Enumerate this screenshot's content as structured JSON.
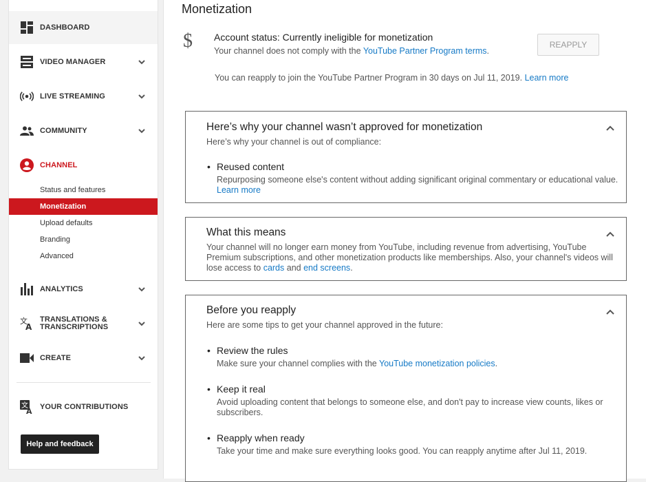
{
  "sidebar": {
    "dashboard": "DASHBOARD",
    "video_manager": "VIDEO MANAGER",
    "live_streaming": "LIVE STREAMING",
    "community": "COMMUNITY",
    "channel": "CHANNEL",
    "channel_sub": [
      "Status and features",
      "Monetization",
      "Upload defaults",
      "Branding",
      "Advanced"
    ],
    "analytics": "ANALYTICS",
    "translations_line1": "TRANSLATIONS &",
    "translations_line2": "TRANSCRIPTIONS",
    "create": "CREATE",
    "contributions": "YOUR CONTRIBUTIONS",
    "help_button": "Help and feedback"
  },
  "main": {
    "title": "Monetization",
    "dollar_glyph": "$",
    "account_status": "Account status: Currently ineligible for monetization",
    "account_sub_text": "Your channel does not comply with the ",
    "account_sub_link": "YouTube Partner Program terms",
    "account_sub_end": ".",
    "reapply_button": "REAPPLY",
    "reapply_note": "You can reapply to join the YouTube Partner Program in 30 days on Jul 11, 2019.",
    "reapply_note_link": "Learn more"
  },
  "cards": {
    "why": {
      "title": "Here’s why your channel wasn’t approved for monetization",
      "subtitle": "Here’s why your channel is out of compliance:",
      "bullet_title": "Reused content",
      "bullet_text": "Repurposing someone else's content without adding significant original commentary or educational value.",
      "bullet_link": "Learn more"
    },
    "means": {
      "title": "What this means",
      "text_part1": "Your channel will no longer earn money from YouTube, including revenue from advertising, YouTube Premium subscriptions, and other monetization products like memberships. Also, your channel's videos will lose access to ",
      "link_cards": "cards",
      "text_and": " and ",
      "link_end_screens": "end screens",
      "text_end": "."
    },
    "before": {
      "title": "Before you reapply",
      "subtitle": "Here are some tips to get your channel approved in the future:",
      "b1_title": "Review the rules",
      "b1_text": "Make sure your channel complies with the ",
      "b1_link": "YouTube monetization policies",
      "b1_end": ".",
      "b2_title": "Keep it real",
      "b2_text": "Avoid uploading content that belongs to someone else, and don't pay to increase view counts, likes or subscribers.",
      "b3_title": "Reapply when ready",
      "b3_text": "Take your time and make sure everything looks good. You can reapply anytime after Jul 11, 2019."
    }
  },
  "colors": {
    "brand_red": "#cc181e",
    "link_blue": "#167ac6",
    "icon_dark": "#333333"
  }
}
